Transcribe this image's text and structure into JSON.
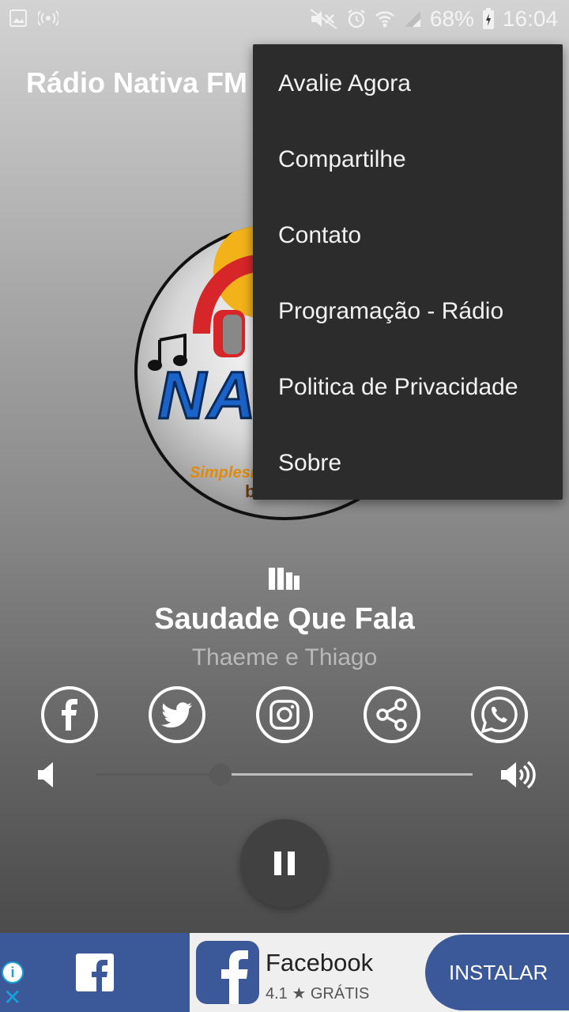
{
  "status_bar": {
    "battery": "68%",
    "time": "16:04",
    "icons": [
      "image-icon",
      "hotspot-icon",
      "mute-icon",
      "alarm-icon",
      "wifi-icon",
      "signal-icon",
      "battery-charging-icon"
    ]
  },
  "app_bar": {
    "title": "Rádio Nativa FM"
  },
  "logo": {
    "text": "NA",
    "slogan": "Simplesm",
    "slogan2": "buri"
  },
  "menu": {
    "items": [
      {
        "label": "Avalie Agora"
      },
      {
        "label": "Compartilhe"
      },
      {
        "label": "Contato"
      },
      {
        "label": "Programação - Rádio"
      },
      {
        "label": "Politica de Privacidade"
      },
      {
        "label": "Sobre"
      }
    ]
  },
  "now_playing": {
    "title": "Saudade Que Fala",
    "artist": "Thaeme e Thiago"
  },
  "social": [
    "facebook-icon",
    "twitter-icon",
    "instagram-icon",
    "share-icon",
    "whatsapp-icon"
  ],
  "volume": {
    "level": 0.33
  },
  "player": {
    "state": "playing"
  },
  "ad": {
    "app_name": "Facebook",
    "rating": "4.1",
    "price": "GRÁTIS",
    "install_label": "INSTALAR",
    "brand_color": "#3b5998"
  }
}
